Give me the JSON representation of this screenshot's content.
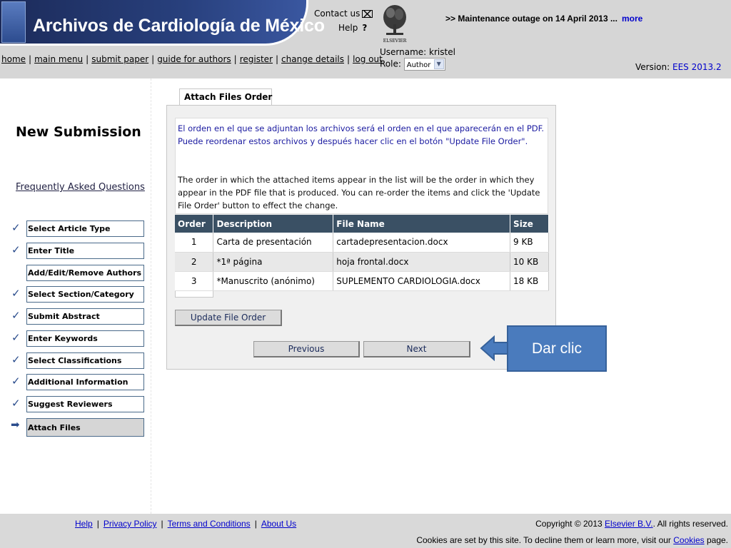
{
  "header": {
    "brand": "Archivos de Cardiología de México",
    "contact_label": "Contact us",
    "help_label": "Help",
    "help_glyph": "?",
    "elsevier_label": "ELSEVIER",
    "maintenance_text": ">> Maintenance outage on 14 April 2013 ...",
    "maintenance_link": "more",
    "nav": [
      "home",
      "main menu",
      "submit paper",
      "guide for authors",
      "register",
      "change details",
      "log out"
    ],
    "username_label": "Username:",
    "username_value": "kristel",
    "role_label": "Role:",
    "role_value": "Author",
    "version_label": "Version:",
    "version_value": "EES 2013.2"
  },
  "sidebar": {
    "title": "New Submission",
    "faq": "Frequently Asked Questions",
    "steps": [
      {
        "label": "Select Article Type",
        "mark": "✓"
      },
      {
        "label": "Enter Title",
        "mark": "✓"
      },
      {
        "label": "Add/Edit/Remove Authors",
        "mark": ""
      },
      {
        "label": "Select Section/Category",
        "mark": "✓"
      },
      {
        "label": "Submit Abstract",
        "mark": "✓"
      },
      {
        "label": "Enter Keywords",
        "mark": "✓"
      },
      {
        "label": "Select Classifications",
        "mark": "✓"
      },
      {
        "label": "Additional Information",
        "mark": "✓"
      },
      {
        "label": "Suggest Reviewers",
        "mark": "✓"
      },
      {
        "label": "Attach Files",
        "mark": "➡"
      }
    ]
  },
  "main": {
    "tab_label": "Attach Files Order",
    "message_es": "El orden en el que se adjuntan los archivos será el orden en el que aparecerán en el PDF. Puede reordenar estos archivos y después hacer clic en el botón \"Update File Order\".",
    "message_en": "The order in which the attached items appear in the list will be the order in which they appear in the PDF file that is produced. You can re-order the items and click the 'Update File Order' button to effect the change.",
    "columns": [
      "Order",
      "Description",
      "File Name",
      "Size"
    ],
    "rows": [
      [
        "1",
        "Carta de presentación",
        "cartadepresentacion.docx",
        "9 KB"
      ],
      [
        "2",
        "*1ª página",
        "hoja frontal.docx",
        "10 KB"
      ],
      [
        "3",
        "*Manuscrito (anónimo)",
        "SUPLEMENTO CARDIOLOGIA.docx",
        "18 KB"
      ]
    ],
    "update_button": "Update File Order",
    "previous_button": "Previous",
    "next_button": "Next"
  },
  "callout": {
    "text": "Dar clic",
    "color": "#4a7bbd"
  },
  "footer": {
    "links": [
      "Help",
      "Privacy Policy",
      "Terms and Conditions",
      "About Us"
    ],
    "copyright_prefix": "Copyright © 2013",
    "copyright_link": "Elsevier B.V.",
    "copyright_suffix": ". All rights reserved.",
    "cookies_prefix": "Cookies are set by this site. To decline them or learn more, visit our",
    "cookies_link": "Cookies",
    "cookies_suffix": "page."
  },
  "colors": {
    "banner": "#28407d",
    "table_header": "#3a5064",
    "link": "#0000cc"
  }
}
